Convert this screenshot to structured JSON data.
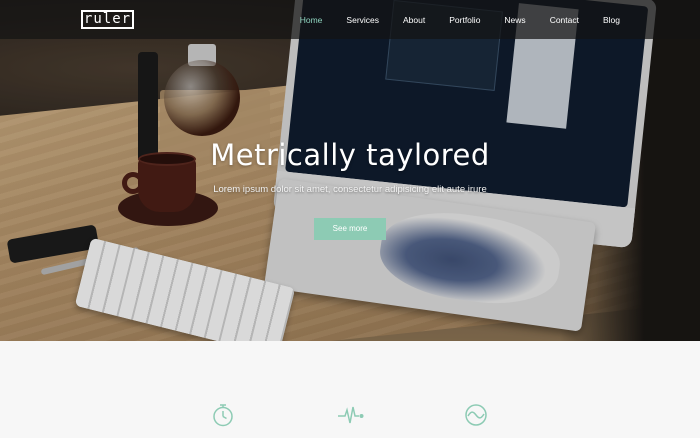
{
  "brand": {
    "logo_text": "ruler"
  },
  "nav": {
    "items": [
      {
        "label": "Home",
        "active": true
      },
      {
        "label": "Services"
      },
      {
        "label": "About"
      },
      {
        "label": "Portfolio"
      },
      {
        "label": "News"
      },
      {
        "label": "Contact"
      },
      {
        "label": "Blog"
      }
    ]
  },
  "hero": {
    "headline": "Metrically taylored",
    "subline": "Lorem ipsum dolor sit amet, consectetur adipisicing elit aute irure",
    "cta_label": "See more"
  },
  "features": {
    "icons": [
      "stopwatch-icon",
      "heartbeat-icon",
      "wave-circle-icon"
    ]
  },
  "colors": {
    "accent": "#8dcbb4",
    "nav_active": "#8fd4bf",
    "icon": "#8dcbb4"
  }
}
